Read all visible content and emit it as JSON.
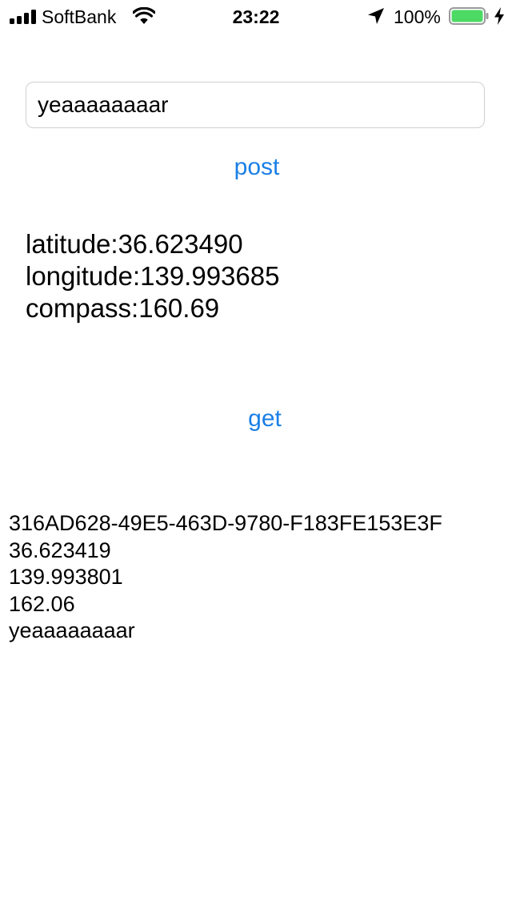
{
  "status_bar": {
    "carrier": "SoftBank",
    "time": "23:22",
    "battery_percent": "100%",
    "signal_bars": 4,
    "battery_level": 1.0,
    "battery_color": "#4cd964"
  },
  "form": {
    "input_value": "yeaaaaaaaar",
    "post_label": "post",
    "get_label": "get",
    "accent_color": "#1a7fe6"
  },
  "location": {
    "latitude": "latitude:36.623490",
    "longitude": "longitude:139.993685",
    "compass": "compass:160.69"
  },
  "result": {
    "lines": [
      "316AD628-49E5-463D-9780-F183FE153E3F",
      "36.623419",
      "139.993801",
      "162.06",
      "yeaaaaaaaar"
    ]
  }
}
